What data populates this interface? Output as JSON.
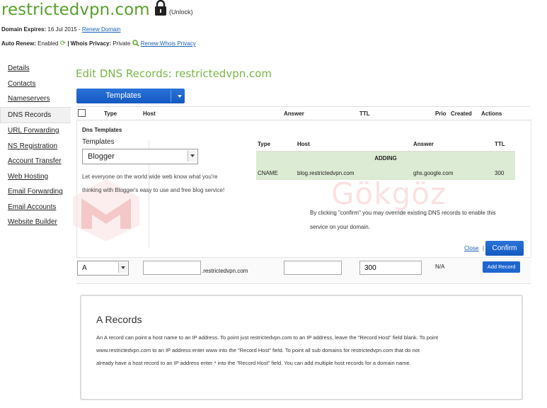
{
  "header": {
    "domain": "restrictedvpn.com",
    "unlock_label": "(Unlock)",
    "expires_label": "Domain Expires:",
    "expires_value": "16 Jul 2015 -",
    "renew_domain": "Renew Domain",
    "auto_renew_label": "Auto Renew:",
    "auto_renew_value": "Enabled",
    "whois_label": "| Whois Privacy:",
    "whois_value": "Private",
    "renew_whois": "Renew Whois Privacy"
  },
  "sidebar": {
    "items": [
      {
        "label": "Details"
      },
      {
        "label": "Contacts"
      },
      {
        "label": "Nameservers"
      },
      {
        "label": "DNS Records",
        "active": true
      },
      {
        "label": "URL Forwarding"
      },
      {
        "label": "NS Registration"
      },
      {
        "label": "Account Transfer"
      },
      {
        "label": "Web Hosting"
      },
      {
        "label": "Email Forwarding"
      },
      {
        "label": "Email Accounts"
      },
      {
        "label": "Website Builder"
      }
    ]
  },
  "main": {
    "heading": "Edit DNS Records: restrictedvpn.com",
    "templates_button": "Templates",
    "columns": [
      "Type",
      "Host",
      "Answer",
      "TTL",
      "Prio",
      "Created",
      "Actions"
    ]
  },
  "templates_panel": {
    "title": "Dns Templates",
    "label": "Templates",
    "selected": "Blogger",
    "desc_line1": "Let everyone on the world wide web know what you're",
    "desc_line2": "thinking with Blogger's easy to use and free blog service!",
    "preview": {
      "columns": [
        "Type",
        "Host",
        "Answer",
        "TTL"
      ],
      "adding": "ADDING",
      "row": {
        "type": "CNAME",
        "host": "blog.restrictedvpn.com",
        "answer": "ghs.google.com",
        "ttl": "300"
      }
    },
    "override_line1": "By clicking \"confirm\" you may override existing DNS records to enable this",
    "override_line2": "service on your domain.",
    "close": "Close",
    "pipe": "|",
    "confirm": "Confirm"
  },
  "add_row": {
    "type": "A",
    "host_value": "",
    "host_suffix": ".restrictedvpn.com",
    "answer_value": "",
    "ttl_value": "300",
    "prio": "N/A",
    "add_button": "Add Record"
  },
  "info": {
    "title": "A Records",
    "line1": "An A record can point a host name to an IP address. To point just restrictedvpn.com to an IP address, leave the \"Record Host\" field blank. To point",
    "line2": "www.restrictedvpn.com to an IP address enter www into the \"Record Host\" field. To point all sub domains for restrictedvpn.com that do not",
    "line3": "already have a host record to an IP address enter * into the \"Record Host\" field. You can add multiple host records for a domain name."
  },
  "watermark": {
    "text": "Gökgöz"
  },
  "colors": {
    "brand_green": "#5aa02c",
    "button_blue": "#1f66cf",
    "adding_bg": "#dcebd3"
  }
}
